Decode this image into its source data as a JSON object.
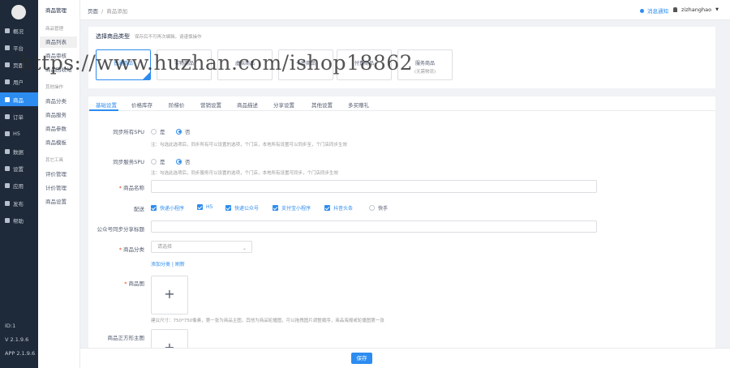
{
  "sidebar": {
    "items": [
      {
        "label": "概况",
        "icon": "overview-icon"
      },
      {
        "label": "平台",
        "icon": "platform-icon"
      },
      {
        "label": "页面",
        "icon": "page-icon"
      },
      {
        "label": "用户",
        "icon": "user-icon"
      },
      {
        "label": "商品",
        "icon": "goods-icon"
      },
      {
        "label": "订单",
        "icon": "order-icon"
      },
      {
        "label": "H5",
        "icon": "h5-icon"
      },
      {
        "label": "数据",
        "icon": "data-icon"
      },
      {
        "label": "设置",
        "icon": "settings-icon"
      },
      {
        "label": "应用",
        "icon": "apps-icon"
      },
      {
        "label": "发布",
        "icon": "publish-icon"
      },
      {
        "label": "帮助",
        "icon": "help-icon"
      }
    ],
    "footer": {
      "id": "ID:1",
      "version": "V 2.1.9.6",
      "app_version": "APP 2.1.9.6"
    }
  },
  "subnav": {
    "title": "商品管理",
    "group1": "商品管理",
    "items1": [
      "商品列表",
      "商品审核",
      "商品回收站"
    ],
    "group2": "其他操作",
    "items2": [
      "商品分类",
      "商品服务",
      "商品参数",
      "商品模板"
    ],
    "group3": "其它工具",
    "items3": [
      "评价管理",
      "计价管理",
      "商品设置"
    ]
  },
  "header": {
    "breadcrumb": [
      "页面",
      "商品添加"
    ],
    "notice": "消息通知",
    "username": "zizhanghao"
  },
  "type_card": {
    "title": "选择商品类型",
    "tip": "保存后不可再次编辑，请谨慎操作",
    "types": [
      {
        "name": "普通商品",
        "sub": ""
      },
      {
        "name": "实物商品",
        "sub": ""
      },
      {
        "name": "虚拟商品",
        "sub": ""
      },
      {
        "name": "卡密商品",
        "sub": ""
      },
      {
        "name": "付费商品",
        "sub": ""
      },
      {
        "name": "服务商品",
        "sub": "(无需物流)"
      }
    ],
    "active_index": 0
  },
  "watermark": "https://www.huzhan.com/ishop18862",
  "tabs": [
    "基础设置",
    "价格库存",
    "阶梯价",
    "营销设置",
    "商品描述",
    "分享设置",
    "其他设置",
    "多买赠礼"
  ],
  "form": {
    "sync_spu": {
      "label": "同步所有SPU",
      "options": [
        "是",
        "否"
      ],
      "selected": "否",
      "note": "注：勾选此选项后，同步所有可以设置的选项，个门店，本地所有设置可以同步至，个门店同步生效"
    },
    "sync_service": {
      "label": "同步服务SPU",
      "options": [
        "是",
        "否"
      ],
      "selected": "否",
      "note": "注：勾选此选项后，同步服务可以设置的选项，个门店，本地所有设置可同步，个门店同步生效"
    },
    "name": {
      "label": "商品名称"
    },
    "delivery": {
      "label": "配送",
      "options": [
        {
          "label": "快递小程序",
          "checked": true
        },
        {
          "label": "H5",
          "checked": true
        },
        {
          "label": "快递公众号",
          "checked": true
        },
        {
          "label": "支付宝小程序",
          "checked": true
        },
        {
          "label": "抖音头条",
          "checked": true
        },
        {
          "label": "快手",
          "checked": false
        }
      ]
    },
    "mp_share": {
      "label": "公众号同步分享标题"
    },
    "category": {
      "label": "商品分类",
      "placeholder": "请选择",
      "links": "添加分类 | 刷新"
    },
    "image": {
      "label": "商品图",
      "note": "建议尺寸：750*750像素，第一张为商品主图，其他为商品轮播图，可以拖拽图片调整顺序，商品海报或轮播图第一张"
    },
    "square_image": {
      "label": "商品正方形主图"
    }
  },
  "footer": {
    "save": "保存"
  }
}
